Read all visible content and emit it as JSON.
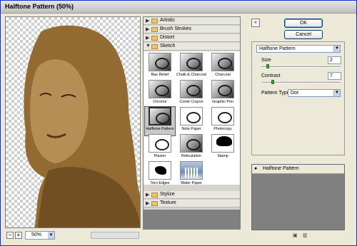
{
  "window": {
    "title": "Halftone Pattern (50%)"
  },
  "preview": {
    "zoom_minus": "−",
    "zoom_plus": "+",
    "zoom_value": "50%"
  },
  "categories": {
    "artistic": "Artistic",
    "brush_strokes": "Brush Strokes",
    "distort": "Distort",
    "sketch": "Sketch",
    "stylize": "Stylize",
    "texture": "Texture"
  },
  "thumbs": [
    "Bas Relief",
    "Chalk & Charcoal",
    "Charcoal",
    "Chrome",
    "Conté Crayon",
    "Graphic Pen",
    "Halftone Pattern",
    "Note Paper",
    "Photocopy",
    "Plaster",
    "Reticulation",
    "Stamp",
    "Torn Edges",
    "Water Paper"
  ],
  "buttons": {
    "ok": "OK",
    "cancel": "Cancel",
    "collapse": "«"
  },
  "options": {
    "filter_select": "Halftone Pattern",
    "size_label": "Size",
    "size_value": "2",
    "contrast_label": "Contrast",
    "contrast_value": "7",
    "pattern_label": "Pattern Type:",
    "pattern_value": "Dot"
  },
  "layers": {
    "row_label": "Halftone Pattern"
  },
  "icons": {
    "new_layer": "new-layer-icon",
    "delete_layer": "trash-icon"
  }
}
